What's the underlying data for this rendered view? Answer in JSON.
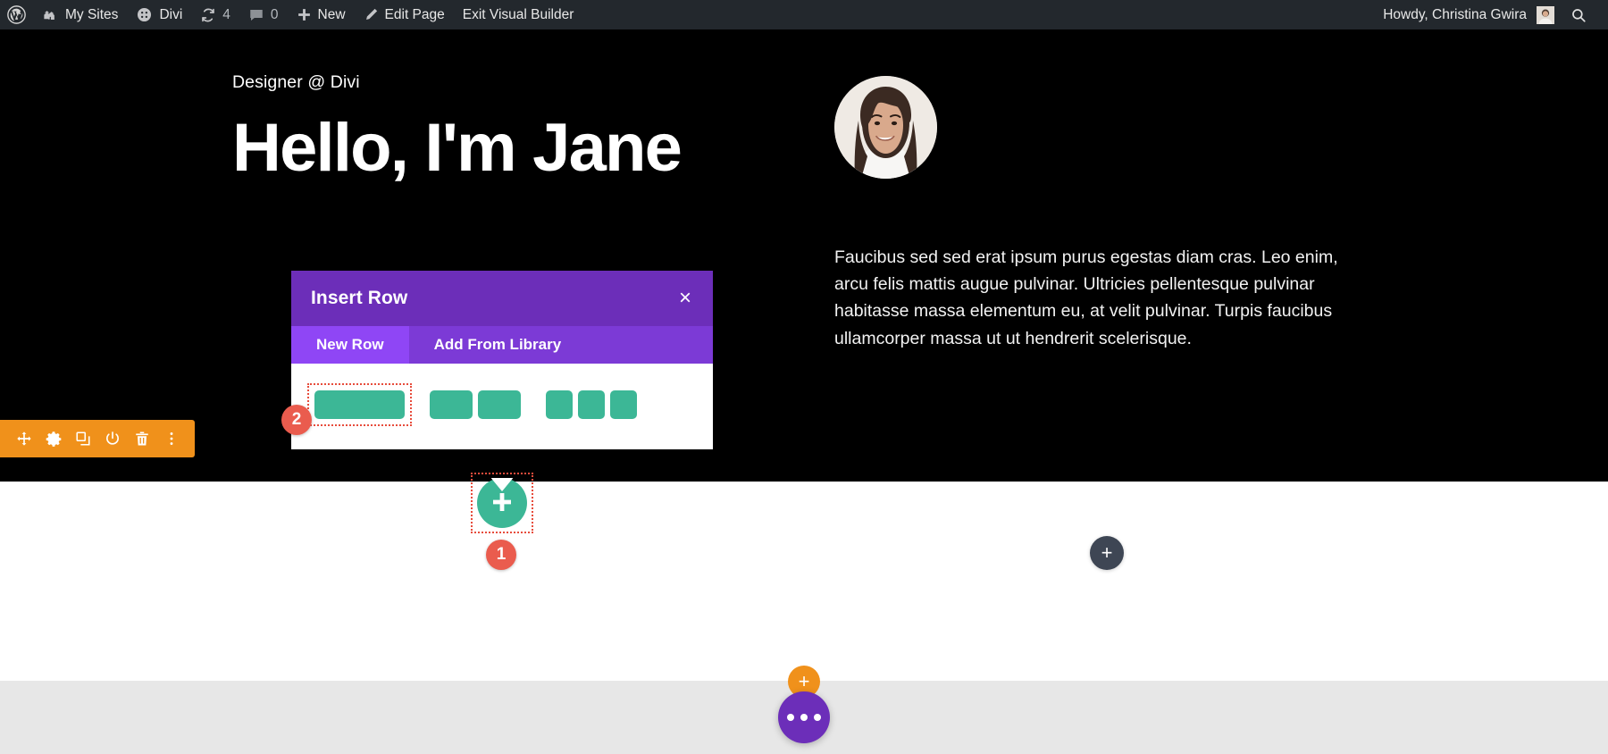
{
  "adminbar": {
    "left_items": [
      {
        "icon": "wordpress-logo-icon",
        "label": ""
      },
      {
        "icon": "my-sites-icon",
        "label": "My Sites"
      },
      {
        "icon": "divi-icon",
        "label": "Divi"
      },
      {
        "icon": "updates-icon",
        "label": "4"
      },
      {
        "icon": "comments-icon",
        "label": "0"
      },
      {
        "icon": "plus-icon",
        "label": "New"
      },
      {
        "icon": "pencil-icon",
        "label": "Edit Page"
      },
      {
        "icon": "none",
        "label": "Exit Visual Builder"
      }
    ],
    "howdy": "Howdy, Christina Gwira",
    "search_icon": "search-icon",
    "bg_color": "#23282d"
  },
  "hero": {
    "eyebrow": "Designer @ Divi",
    "title": "Hello, I'm Jane",
    "paragraph": "Faucibus sed sed erat ipsum purus egestas diam cras. Leo enim, arcu felis mattis augue pulvinar. Ultricies pellentesque pulvinar habitasse massa elementum eu, at velit pulvinar. Turpis faucibus ullamcorper massa ut ut hendrerit scelerisque.",
    "avatar_alt": "portrait-photo",
    "bg_color": "#000000"
  },
  "section_toolbar": {
    "color": "#f0911b",
    "buttons": [
      {
        "name": "move-icon",
        "title": "Move Section"
      },
      {
        "name": "gear-icon",
        "title": "Section Settings"
      },
      {
        "name": "duplicate-icon",
        "title": "Duplicate Section"
      },
      {
        "name": "power-icon",
        "title": "Disable Section"
      },
      {
        "name": "trash-icon",
        "title": "Delete Section"
      },
      {
        "name": "more-vertical-icon",
        "title": "More Options"
      }
    ]
  },
  "modal": {
    "title": "Insert Row",
    "close_label": "×",
    "header_color": "#6c2eb9",
    "tabs": [
      {
        "label": "New Row",
        "active": true
      },
      {
        "label": "Add From Library",
        "active": false
      }
    ],
    "row_layouts": [
      {
        "name": "one-column",
        "columns": 1,
        "selected": true
      },
      {
        "name": "two-column",
        "columns": 2,
        "selected": false
      },
      {
        "name": "three-column",
        "columns": 3,
        "selected": false
      }
    ],
    "cell_color": "#3cb796"
  },
  "markers": [
    {
      "id": "1",
      "label": "1",
      "target": "add-row-button",
      "color": "#ea5c4e"
    },
    {
      "id": "2",
      "label": "2",
      "target": "one-column-row-layout",
      "color": "#ea5c4e"
    }
  ],
  "buttons": {
    "add_row_label": "+",
    "add_module_label": "+",
    "bottom_add_label": "+",
    "bottom_menu_label": "•••"
  },
  "colors": {
    "divi_purple": "#6c2eb9",
    "divi_purple_light": "#8f46f5",
    "divi_orange": "#f0911b",
    "divi_teal": "#3cb796",
    "marker_red": "#ea5c4e",
    "dark_gray": "#3e4654",
    "gray_section": "#e7e7e7"
  }
}
